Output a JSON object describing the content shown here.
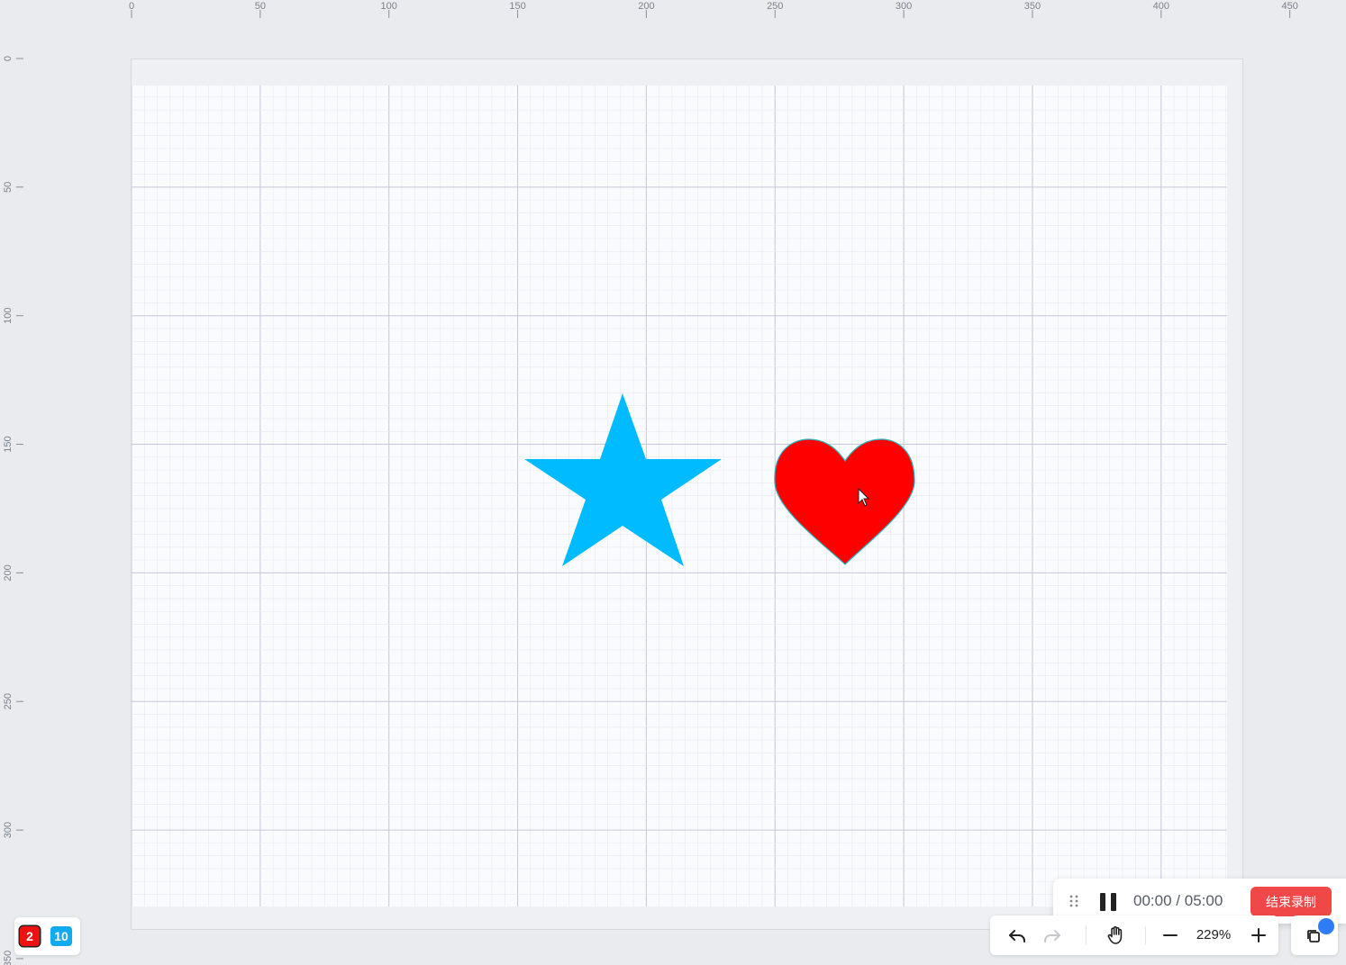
{
  "rulers": {
    "top_labels": [
      "0",
      "50",
      "100",
      "150",
      "200",
      "250",
      "300",
      "350",
      "400",
      "450"
    ],
    "left_labels": [
      "0",
      "50",
      "100",
      "150",
      "200",
      "250",
      "300",
      "350"
    ]
  },
  "shapes": {
    "star": {
      "fill": "#00bbff"
    },
    "heart": {
      "fill": "#ff0000",
      "stroke": "#2bb5bd"
    }
  },
  "badges": {
    "red_count": "2",
    "blue_count": "10"
  },
  "recording": {
    "elapsed": "00:00",
    "separator": "/",
    "limit": "05:00",
    "end_label": "结束录制"
  },
  "toolbar": {
    "zoom": "229%"
  },
  "colors": {
    "accent_red": "#f04848",
    "badge_blue": "#11aaee",
    "layers_dot": "#2e7cf6",
    "grid_major": "#c5c8d8"
  }
}
